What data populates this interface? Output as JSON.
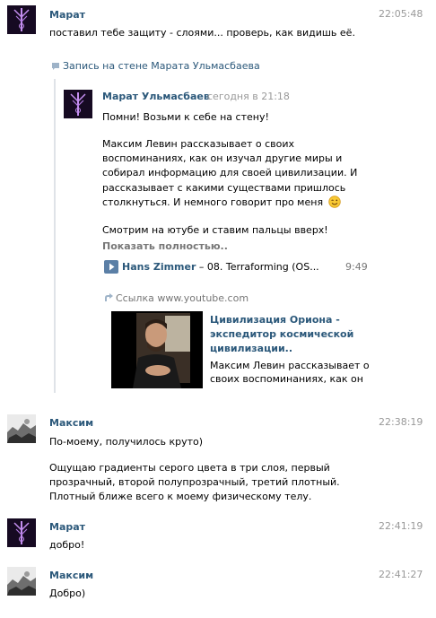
{
  "messages": [
    {
      "author": "Марат",
      "time": "22:05:48",
      "lines": [
        "поставил тебе защиту - слоями... проверь, как видишь её."
      ]
    },
    {
      "author": "Максим",
      "time": "22:38:19",
      "lines": [
        "По-моему, получилось круто)",
        "Ощущаю градиенты серого цвета в три слоя, первый",
        "прозрачный, второй полупрозрачный, третий плотный.",
        "Плотный ближе всего к моему физическому телу."
      ]
    },
    {
      "author": "Марат",
      "time": "22:41:19",
      "lines": [
        "добро!"
      ]
    },
    {
      "author": "Максим",
      "time": "22:41:27",
      "lines": [
        "Добро)"
      ]
    }
  ],
  "wall_post": {
    "label": "Запись на стене Марата Ульмасбаева",
    "author": "Марат Ульмасбаев",
    "time": "сегодня в 21:18",
    "text_lines": [
      "Помни! Возьми к себе на стену!",
      "Максим Левин рассказывает о своих",
      "воспоминаниях, как он изучал другие миры и",
      "собирал информацию для своей цивилизации. И",
      "рассказывает с какими существами пришлось",
      "столкнуться. И немного говорит про меня",
      "Смотрим на ютубе и ставим пальцы вверх!"
    ],
    "show_more": "Показать полностью..",
    "audio": {
      "artist": "Hans Zimmer",
      "separator": " – ",
      "title": "08. Terraforming (OS...",
      "duration": "9:49"
    },
    "link_label": "Ссылка www.youtube.com",
    "video": {
      "title_lines": [
        "Цивилизация Ориона -",
        "экспедитор космической",
        "цивилизации.."
      ],
      "desc_lines": [
        "Максим Левин рассказывает о",
        "своих воспоминаниях, как он"
      ]
    }
  },
  "colors": {
    "link": "#2b587a",
    "time": "#999999",
    "repost_bar": "#dfe3e8",
    "play_button": "#5b7fa6"
  },
  "icons": {
    "repost": "speech-bubble-icon",
    "play": "play-icon",
    "link": "link-arrow-icon",
    "emoji": "wink-emoji-icon"
  }
}
